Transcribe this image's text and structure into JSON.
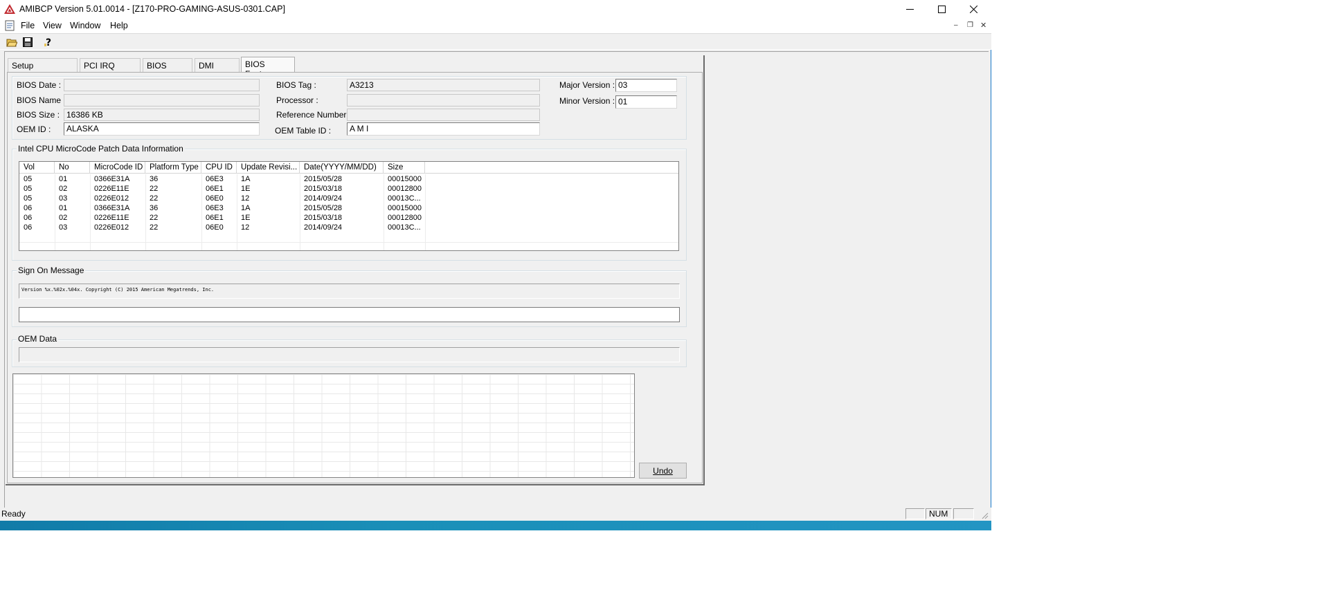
{
  "window": {
    "title": "AMIBCP Version 5.01.0014 - [Z170-PRO-GAMING-ASUS-0301.CAP]",
    "minimize_icon": "minimize-icon",
    "maximize_icon": "maximize-icon",
    "close_icon": "close-icon"
  },
  "menu": [
    "File",
    "View",
    "Window",
    "Help"
  ],
  "tabs": [
    "Setup Configuration",
    "PCI IRQ Routing",
    "BIOS Strings",
    "DMI Tables",
    "BIOS Features"
  ],
  "active_tab": "BIOS Features",
  "bios_info": {
    "bios_date_label": "BIOS Date :",
    "bios_date": "",
    "bios_name_label": "BIOS Name :",
    "bios_name": "",
    "bios_size_label": "BIOS Size :",
    "bios_size": "16386 KB",
    "oem_id_label": "OEM ID :",
    "oem_id": "ALASKA",
    "bios_tag_label": "BIOS Tag :",
    "bios_tag": "A3213",
    "processor_label": "Processor :",
    "processor": "",
    "reference_number_label": "Reference Number :",
    "reference_number": "",
    "oem_table_id_label": "OEM Table ID :",
    "oem_table_id": "A M I",
    "major_version_label": "Major Version :",
    "major_version": "03",
    "minor_version_label": "Minor Version :",
    "minor_version": "01"
  },
  "microcode": {
    "title": "Intel CPU MicroCode Patch Data Information",
    "columns": [
      "Vol",
      "No",
      "MicroCode ID",
      "Platform Type",
      "CPU ID",
      "Update Revisi...",
      "Date(YYYY/MM/DD)",
      "Size"
    ],
    "rows": [
      [
        "05",
        "01",
        "0366E31A",
        "36",
        "06E3",
        "1A",
        "2015/05/28",
        "00015000"
      ],
      [
        "05",
        "02",
        "0226E11E",
        "22",
        "06E1",
        "1E",
        "2015/03/18",
        "00012800"
      ],
      [
        "05",
        "03",
        "0226E012",
        "22",
        "06E0",
        "12",
        "2014/09/24",
        "00013C..."
      ],
      [
        "06",
        "01",
        "0366E31A",
        "36",
        "06E3",
        "1A",
        "2015/05/28",
        "00015000"
      ],
      [
        "06",
        "02",
        "0226E11E",
        "22",
        "06E1",
        "1E",
        "2015/03/18",
        "00012800"
      ],
      [
        "06",
        "03",
        "0226E012",
        "22",
        "06E0",
        "12",
        "2014/09/24",
        "00013C..."
      ]
    ]
  },
  "sign_on": {
    "title": "Sign On Message",
    "line1": "Version %x.%02x.%04x. Copyright (C) 2015 American Megatrends, Inc.",
    "line2": ""
  },
  "oem_data": {
    "title": "OEM Data",
    "value": ""
  },
  "undo_label": "Undo",
  "status": {
    "text": "Ready",
    "num": "NUM"
  },
  "colors": {
    "window_bg": "#f0f0f0",
    "accent": "#1979ca",
    "taskbar": "#1a8fb8"
  }
}
